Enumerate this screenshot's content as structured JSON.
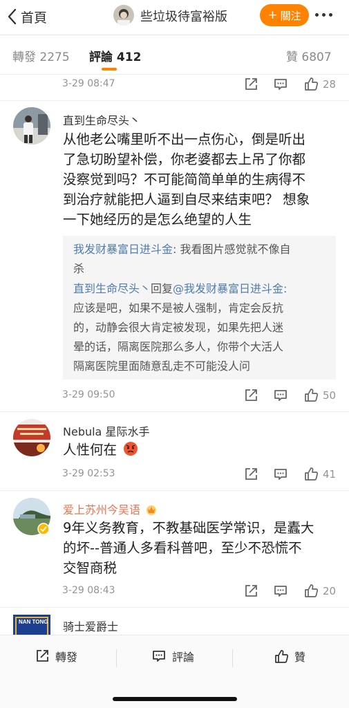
{
  "header": {
    "back_label": "首頁",
    "title": "些垃圾待富裕版",
    "follow_label": "關注",
    "follow_plus": "+"
  },
  "tabs": {
    "repost_label": "轉發",
    "repost_count": "2275",
    "comment_label": "評論",
    "comment_count": "412",
    "like_label": "贊",
    "like_count": "6807"
  },
  "colors": {
    "accent": "#ff8200",
    "link": "#507daf",
    "vip_name": "#eb7350"
  },
  "comments": [
    {
      "time": "3-29 08:47",
      "likes": "28"
    },
    {
      "user": "直到生命尽头丶",
      "text_lines": [
        "从他老公嘴里听不出一点伤心，倒是听出",
        "了急切盼望补偿，你老婆都去上吊了你都",
        "没察觉到吗？不可能简简单单的生病得不",
        "到治疗就能把人逼到自尽来结束吧？ 想象",
        "一下她经历的是怎么绝望的人生"
      ],
      "replies": [
        {
          "user": "我发财暴富日进斗金",
          "colon": ":",
          "text1": " 我看图片感觉就不像自",
          "text2": "杀"
        },
        {
          "user": "直到生命尽头丶",
          "reply_word": "回复",
          "target": "@我发财暴富日进斗金",
          "colon": ":",
          "lines": [
            "应该是吧，如果不是被人强制，肯定会反抗",
            "的，动静会很大肯定被发现，如果先把人迷",
            "晕的话，隔离医院那么多人，你带个大活人",
            "隔离医院里面随意乱走不可能没人问"
          ]
        }
      ],
      "time": "3-29 09:50",
      "likes": "50"
    },
    {
      "user": "Nebula 星际水手",
      "text": "人性何在",
      "time": "3-29 02:53",
      "likes": "41"
    },
    {
      "user": "爱上苏州今吴语",
      "text_lines": [
        "9年义务教育，不教基础医学常识，是蠹大",
        "的坏--普通人多看科普吧，至少不恐慌不",
        "交智商税"
      ],
      "time": "3-29 08:43",
      "likes": "20"
    },
    {
      "user": "骑士爱爵士",
      "avatar_text": "NAN TONG"
    }
  ],
  "bottom_bar": {
    "repost_label": "轉發",
    "comment_label": "評論",
    "like_label": "贊"
  }
}
